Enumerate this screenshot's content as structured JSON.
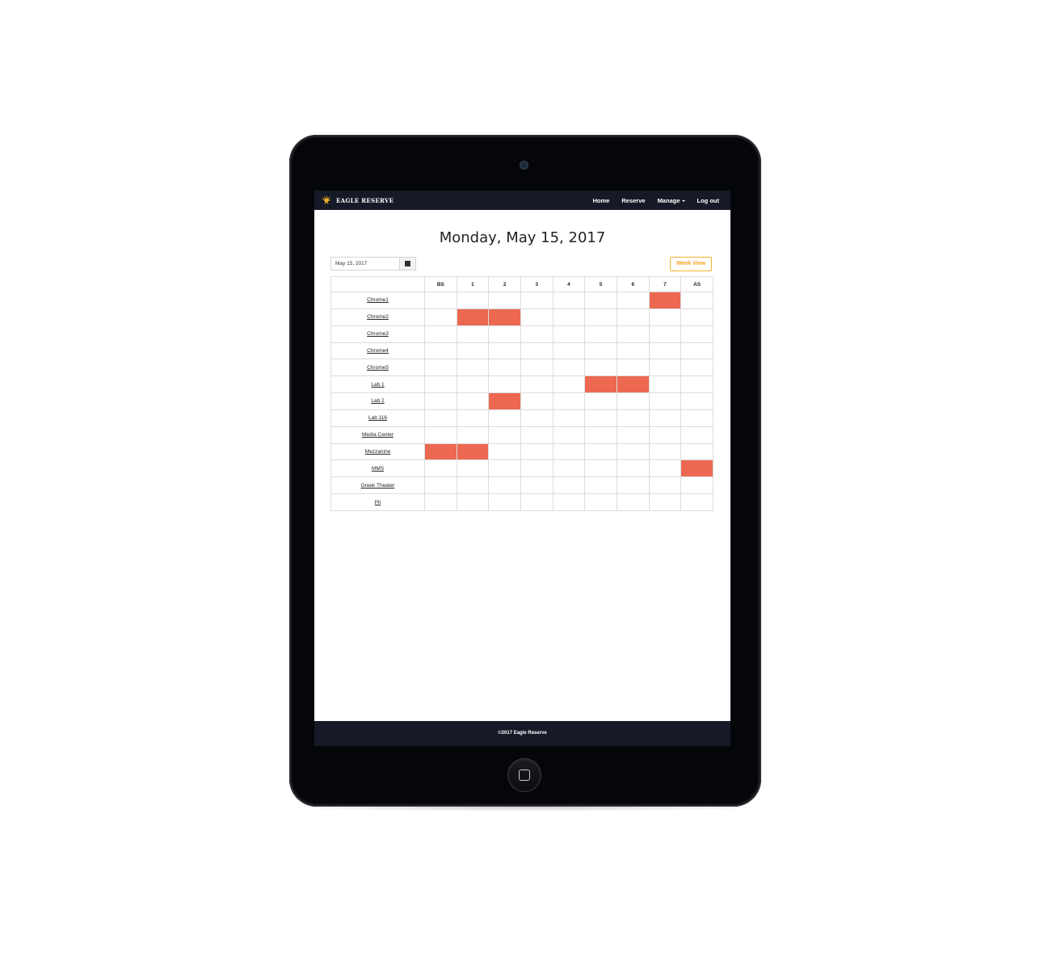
{
  "navbar": {
    "brand": "EAGLE RESERVE",
    "links": [
      {
        "label": "Home"
      },
      {
        "label": "Reserve"
      },
      {
        "label": "Manage"
      },
      {
        "label": "Log out"
      }
    ]
  },
  "page": {
    "title": "Monday, May 15, 2017"
  },
  "controls": {
    "date_value": "May 15, 2017",
    "week_view_label": "Week View"
  },
  "schedule": {
    "periods": [
      "BS",
      "1",
      "2",
      "3",
      "4",
      "5",
      "6",
      "7",
      "AS"
    ],
    "reserved_color": "#ec6851",
    "rooms": [
      {
        "name": "Chrome1",
        "reserved": [
          "7"
        ]
      },
      {
        "name": "Chrome2",
        "reserved": [
          "1",
          "2"
        ]
      },
      {
        "name": "Chrome3",
        "reserved": []
      },
      {
        "name": "Chrome4",
        "reserved": []
      },
      {
        "name": "Chrome5",
        "reserved": []
      },
      {
        "name": "Lab 1",
        "reserved": [
          "5",
          "6"
        ]
      },
      {
        "name": "Lab 2",
        "reserved": [
          "2"
        ]
      },
      {
        "name": "Lab 116",
        "reserved": []
      },
      {
        "name": "Media Center",
        "reserved": []
      },
      {
        "name": "Mezzanine",
        "reserved": [
          "BS",
          "1"
        ]
      },
      {
        "name": "MMS",
        "reserved": [
          "AS"
        ]
      },
      {
        "name": "Greek Theater",
        "reserved": []
      },
      {
        "name": "Pit",
        "reserved": []
      }
    ]
  },
  "footer": {
    "text": "©2017 Eagle Reserve"
  },
  "colors": {
    "navbar_bg": "#151a26",
    "accent": "#f6b52e",
    "reserved": "#ec6851"
  }
}
